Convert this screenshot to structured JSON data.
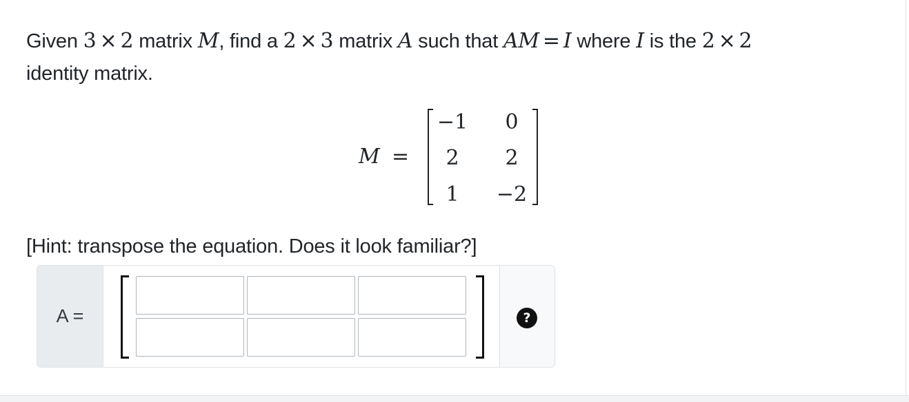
{
  "prompt": {
    "w1": "Given ",
    "rows3": "3",
    "times1": "×",
    "cols2": "2",
    "w2": " matrix ",
    "M1": "M",
    "w3": ", find a ",
    "rows2": "2",
    "times2": "×",
    "cols3": "3",
    "w4": " matrix ",
    "A1": "A",
    "w5": " such that ",
    "AM": "AM",
    "equals": "=",
    "I1": "I",
    "w6": " where ",
    "I2": "I",
    "w7": " is the ",
    "n1": "2",
    "times3": "×",
    "n2": "2",
    "w8": "identity matrix."
  },
  "display": {
    "lhs": "M",
    "equals": "=",
    "matrix": [
      [
        "−1",
        "0"
      ],
      [
        "2",
        "2"
      ],
      [
        "1",
        "−2"
      ]
    ]
  },
  "hint": "[Hint: transpose the equation. Does it look familiar?]",
  "answer": {
    "label": "A =",
    "cells": [
      [
        "",
        "",
        ""
      ],
      [
        "",
        "",
        ""
      ]
    ],
    "help_icon_glyph": "?"
  }
}
